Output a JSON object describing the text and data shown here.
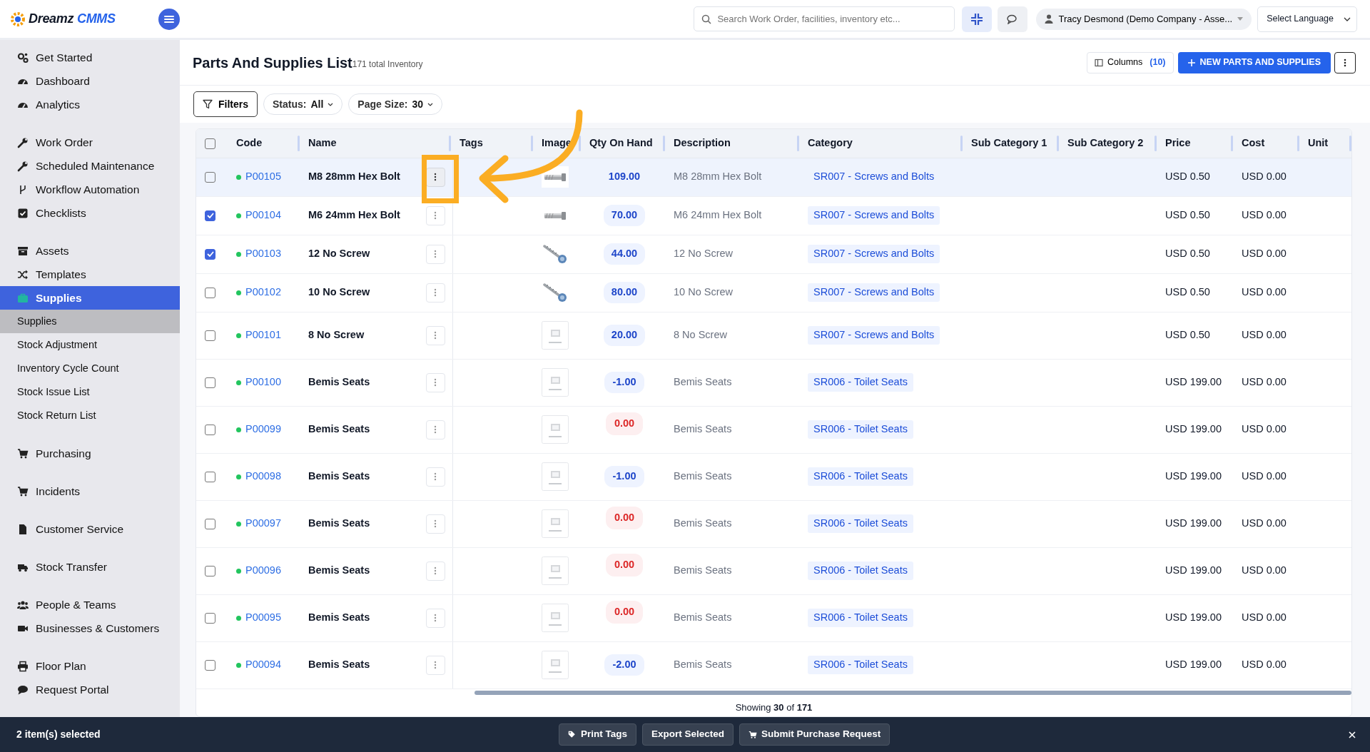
{
  "app": {
    "logo_primary": "Dreamz",
    "logo_secondary": "CMMS"
  },
  "topbar": {
    "search": {
      "placeholder": "Search Work Order, facilities, inventory etc..."
    },
    "user": "Tracy Desmond (Demo Company - Asse...",
    "language": "Select Language"
  },
  "sidebar": {
    "groups": [
      [
        {
          "label": "Get Started",
          "selected": false
        },
        {
          "label": "Dashboard",
          "selected": false
        },
        {
          "label": "Analytics",
          "selected": false
        }
      ],
      [
        {
          "label": "Work Order",
          "selected": false
        },
        {
          "label": "Scheduled Maintenance",
          "selected": false
        },
        {
          "label": "Workflow Automation",
          "selected": false
        },
        {
          "label": "Checklists",
          "selected": false
        }
      ],
      [
        {
          "label": "Assets",
          "selected": false
        },
        {
          "label": "Templates",
          "selected": false
        },
        {
          "label": "Supplies",
          "selected": true,
          "children": [
            {
              "label": "Supplies",
              "selected": true
            },
            {
              "label": "Stock Adjustment",
              "selected": false
            },
            {
              "label": "Inventory Cycle Count",
              "selected": false
            },
            {
              "label": "Stock Issue List",
              "selected": false
            },
            {
              "label": "Stock Return List",
              "selected": false
            }
          ]
        }
      ],
      [
        {
          "label": "Purchasing",
          "selected": false
        }
      ],
      [
        {
          "label": "Incidents",
          "selected": false
        }
      ],
      [
        {
          "label": "Customer Service",
          "selected": false
        }
      ],
      [
        {
          "label": "Stock Transfer",
          "selected": false
        }
      ],
      [
        {
          "label": "People & Teams",
          "selected": false
        },
        {
          "label": "Businesses & Customers",
          "selected": false
        }
      ],
      [
        {
          "label": "Floor Plan",
          "selected": false
        },
        {
          "label": "Request Portal",
          "selected": false
        }
      ]
    ]
  },
  "page": {
    "title": "Parts And Supplies List",
    "subtitle": "171 total Inventory",
    "columns_button": {
      "label": "Columns",
      "count": "(10)"
    },
    "new_button": "NEW PARTS AND SUPPLIES"
  },
  "filters": {
    "filters_button": "Filters",
    "status": {
      "label": "Status:",
      "value": "All"
    },
    "page_size": {
      "label": "Page Size:",
      "value": "30"
    }
  },
  "table": {
    "select_all": false,
    "columns": [
      "Code",
      "Name",
      "Tags",
      "Image",
      "Qty On Hand",
      "Description",
      "Category",
      "Sub Category 1",
      "Sub Category 2",
      "Price",
      "Cost",
      "Unit"
    ],
    "rows": [
      {
        "checked": false,
        "hovered": true,
        "code": "P00105",
        "name": "M8 28mm Hex Bolt",
        "kind": "bolt",
        "qty": "109.00",
        "qty_alert": false,
        "description": "M8 28mm Hex Bolt",
        "category": "SR007 - Screws and Bolts",
        "price": "USD 0.50",
        "cost": "USD 0.00"
      },
      {
        "checked": true,
        "hovered": false,
        "code": "P00104",
        "name": "M6 24mm Hex Bolt",
        "kind": "bolt",
        "qty": "70.00",
        "qty_alert": false,
        "description": "M6 24mm Hex Bolt",
        "category": "SR007 - Screws and Bolts",
        "price": "USD 0.50",
        "cost": "USD 0.00"
      },
      {
        "checked": true,
        "hovered": false,
        "code": "P00103",
        "name": "12 No Screw",
        "kind": "screw",
        "qty": "44.00",
        "qty_alert": false,
        "description": "12 No Screw",
        "category": "SR007 - Screws and Bolts",
        "price": "USD 0.50",
        "cost": "USD 0.00"
      },
      {
        "checked": false,
        "hovered": false,
        "code": "P00102",
        "name": "10 No Screw",
        "kind": "screw",
        "qty": "80.00",
        "qty_alert": false,
        "description": "10 No Screw",
        "category": "SR007 - Screws and Bolts",
        "price": "USD 0.50",
        "cost": "USD 0.00"
      },
      {
        "checked": false,
        "hovered": false,
        "code": "P00101",
        "name": "8 No Screw",
        "kind": "noimage",
        "qty": "20.00",
        "qty_alert": false,
        "description": "8 No Screw",
        "category": "SR007 - Screws and Bolts",
        "price": "USD 0.50",
        "cost": "USD 0.00"
      },
      {
        "checked": false,
        "hovered": false,
        "code": "P00100",
        "name": "Bemis Seats",
        "kind": "noimage",
        "qty": "-1.00",
        "qty_alert": false,
        "description": "Bemis Seats",
        "category": "SR006 - Toilet Seats",
        "price": "USD 199.00",
        "cost": "USD 0.00"
      },
      {
        "checked": false,
        "hovered": false,
        "code": "P00099",
        "name": "Bemis Seats",
        "kind": "noimage",
        "qty": "0.00",
        "qty_alert": true,
        "description": "Bemis Seats",
        "category": "SR006 - Toilet Seats",
        "price": "USD 199.00",
        "cost": "USD 0.00"
      },
      {
        "checked": false,
        "hovered": false,
        "code": "P00098",
        "name": "Bemis Seats",
        "kind": "noimage",
        "qty": "-1.00",
        "qty_alert": false,
        "description": "Bemis Seats",
        "category": "SR006 - Toilet Seats",
        "price": "USD 199.00",
        "cost": "USD 0.00"
      },
      {
        "checked": false,
        "hovered": false,
        "code": "P00097",
        "name": "Bemis Seats",
        "kind": "noimage",
        "qty": "0.00",
        "qty_alert": true,
        "description": "Bemis Seats",
        "category": "SR006 - Toilet Seats",
        "price": "USD 199.00",
        "cost": "USD 0.00"
      },
      {
        "checked": false,
        "hovered": false,
        "code": "P00096",
        "name": "Bemis Seats",
        "kind": "noimage",
        "qty": "0.00",
        "qty_alert": true,
        "description": "Bemis Seats",
        "category": "SR006 - Toilet Seats",
        "price": "USD 199.00",
        "cost": "USD 0.00"
      },
      {
        "checked": false,
        "hovered": false,
        "code": "P00095",
        "name": "Bemis Seats",
        "kind": "noimage",
        "qty": "0.00",
        "qty_alert": true,
        "description": "Bemis Seats",
        "category": "SR006 - Toilet Seats",
        "price": "USD 199.00",
        "cost": "USD 0.00"
      },
      {
        "checked": false,
        "hovered": false,
        "code": "P00094",
        "name": "Bemis Seats",
        "kind": "noimage",
        "qty": "-2.00",
        "qty_alert": false,
        "description": "Bemis Seats",
        "category": "SR006 - Toilet Seats",
        "price": "USD 199.00",
        "cost": "USD 0.00"
      }
    ]
  },
  "footer": "Showing **30** of **171**",
  "selection_bar": {
    "count_text": "2 item(s) selected",
    "actions": [
      {
        "label": "Print Tags",
        "kind": "tag"
      },
      {
        "label": "Export Selected",
        "kind": "plain"
      },
      {
        "label": "Submit Purchase Request",
        "kind": "cart"
      }
    ]
  }
}
